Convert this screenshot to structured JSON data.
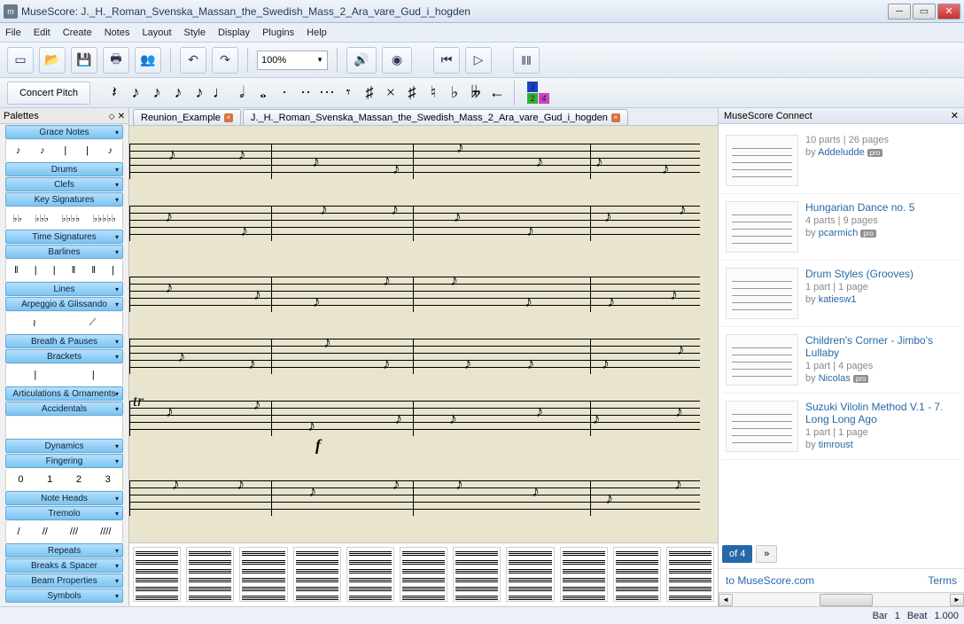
{
  "window": {
    "title": "MuseScore: J._H._Roman_Svenska_Massan_the_Swedish_Mass_2_Ara_vare_Gud_i_hogden",
    "appicon": "m"
  },
  "menubar": [
    "File",
    "Edit",
    "Create",
    "Notes",
    "Layout",
    "Style",
    "Display",
    "Plugins",
    "Help"
  ],
  "toolbar1": {
    "zoom": "100%",
    "icons": [
      "new-file",
      "open-file",
      "save",
      "print",
      "group",
      "undo",
      "redo"
    ],
    "playback": [
      "speaker",
      "metronome",
      "rewind",
      "play",
      "loop"
    ]
  },
  "toolbar2": {
    "concert_pitch": "Concert Pitch",
    "note_glyphs": [
      "𝄽",
      "♪",
      "♪",
      "♪",
      "♪",
      "♩",
      "𝅗𝅥",
      "𝅝",
      "·",
      "··",
      "···",
      "𝄾",
      "♯",
      "×",
      "♯",
      "♮",
      "♭",
      "𝄫",
      "←"
    ],
    "voices": [
      {
        "n": "3",
        "bg": "#1a40d0"
      },
      {
        "n": "2",
        "bg": "#30b030"
      },
      {
        "n": "4",
        "bg": "#d040c0"
      }
    ]
  },
  "palettes": {
    "title": "Palettes",
    "sections": [
      {
        "label": "Grace Notes",
        "row": [
          "♪",
          "♪",
          "|",
          "|",
          "♪"
        ]
      },
      {
        "label": "Drums"
      },
      {
        "label": "Clefs"
      },
      {
        "label": "Key Signatures",
        "row": [
          "♭♭",
          "♭♭♭",
          "♭♭♭♭",
          "♭♭♭♭♭"
        ]
      },
      {
        "label": "Time Signatures"
      },
      {
        "label": "Barlines",
        "row": [
          "‖",
          "|",
          "|",
          "‖",
          "‖",
          "|"
        ]
      },
      {
        "label": "Lines"
      },
      {
        "label": "Arpeggio & Glissando",
        "row": [
          "≀",
          "⟋"
        ]
      },
      {
        "label": "Breath & Pauses"
      },
      {
        "label": "Brackets",
        "row": [
          "|",
          "|"
        ]
      },
      {
        "label": "Articulations & Ornaments"
      },
      {
        "label": "Accidentals",
        "row": [
          "",
          "",
          "",
          ""
        ]
      },
      {
        "label": "Dynamics"
      },
      {
        "label": "Fingering",
        "row": [
          "0",
          "1",
          "2",
          "3"
        ]
      },
      {
        "label": "Note Heads"
      },
      {
        "label": "Tremolo",
        "row": [
          "/",
          "//",
          "///",
          "////"
        ]
      },
      {
        "label": "Repeats"
      },
      {
        "label": "Breaks & Spacer"
      },
      {
        "label": "Beam Properties"
      },
      {
        "label": "Symbols"
      }
    ]
  },
  "tabs": [
    {
      "label": "Reunion_Example",
      "active": false
    },
    {
      "label": "J._H._Roman_Svenska_Massan_the_Swedish_Mass_2_Ara_vare_Gud_i_hogden",
      "active": true
    }
  ],
  "score": {
    "markings": {
      "tr": "tr",
      "f": "f"
    }
  },
  "connect": {
    "title": "MuseScore Connect",
    "items": [
      {
        "title": "",
        "meta": "10 parts | 26 pages",
        "by": "Addeludde",
        "pro": true
      },
      {
        "title": "Hungarian Dance no. 5",
        "meta": "4 parts | 9 pages",
        "by": "pcarmich",
        "pro": true
      },
      {
        "title": "Drum Styles (Grooves)",
        "meta": "1 part | 1 page",
        "by": "katiesw1",
        "pro": false
      },
      {
        "title": "Children's Corner - Jimbo's Lullaby",
        "meta": "1 part | 4 pages",
        "by": "Nicolas",
        "pro": true
      },
      {
        "title": "Suzuki Vilolin Method V.1 - 7. Long Long Ago",
        "meta": "1 part | 1 page",
        "by": "timroust",
        "pro": false
      }
    ],
    "pager": "of 4",
    "footer_link": "to MuseScore.com",
    "footer_terms": "Terms"
  },
  "statusbar": {
    "bar": "Bar",
    "bar_n": "1",
    "beat": "Beat",
    "beat_n": "1.000"
  }
}
